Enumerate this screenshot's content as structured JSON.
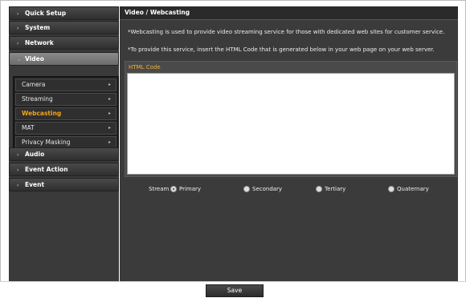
{
  "sidebar": {
    "menus": [
      {
        "label": "Quick Setup"
      },
      {
        "label": "System"
      },
      {
        "label": "Network"
      },
      {
        "label": "Video"
      },
      {
        "label": "Audio"
      },
      {
        "label": "Event Action"
      },
      {
        "label": "Event"
      }
    ],
    "video_submenu": [
      {
        "label": "Camera"
      },
      {
        "label": "Streaming"
      },
      {
        "label": "Webcasting"
      },
      {
        "label": "MAT"
      },
      {
        "label": "Privacy Masking"
      }
    ]
  },
  "main": {
    "title": "Video / Webcasting",
    "note1": "*Webcasting is used to provide video streaming service for those with dedicated web sites for customer service.",
    "note2": "*To provide this service, insert the HTML Code that is generated below in your web page on your web server.",
    "html_code_label": "HTML Code",
    "html_code_value": "",
    "stream_label": "Stream",
    "stream_options": [
      {
        "label": "Primary"
      },
      {
        "label": "Secondary"
      },
      {
        "label": "Tertiary"
      },
      {
        "label": "Quaternary"
      }
    ],
    "selected_stream": "Primary"
  },
  "footer": {
    "save_label": "Save"
  },
  "colors": {
    "accent": "#f5a31a",
    "panel": "#3b3b3b"
  }
}
